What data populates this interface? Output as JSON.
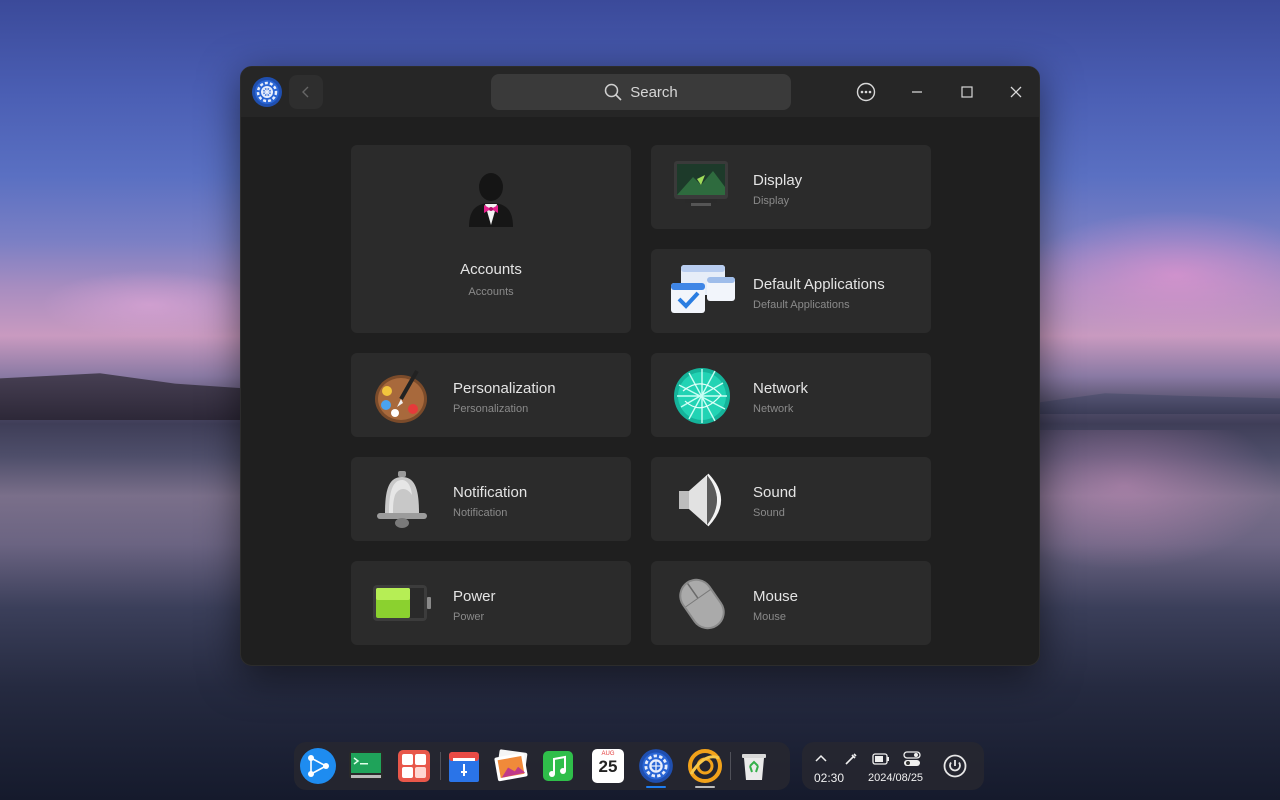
{
  "window": {
    "search_placeholder": "Search"
  },
  "cards": [
    {
      "id": "accounts",
      "title": "Accounts",
      "subtitle": "Accounts",
      "icon": "user-tuxedo-icon"
    },
    {
      "id": "display",
      "title": "Display",
      "subtitle": "Display",
      "icon": "monitor-icon"
    },
    {
      "id": "default-applications",
      "title": "Default Applications",
      "subtitle": "Default Applications",
      "icon": "app-windows-check-icon"
    },
    {
      "id": "personalization",
      "title": "Personalization",
      "subtitle": "Personalization",
      "icon": "paint-palette-icon"
    },
    {
      "id": "network",
      "title": "Network",
      "subtitle": "Network",
      "icon": "network-globe-icon"
    },
    {
      "id": "notification",
      "title": "Notification",
      "subtitle": "Notification",
      "icon": "bell-icon"
    },
    {
      "id": "sound",
      "title": "Sound",
      "subtitle": "Sound",
      "icon": "speaker-icon"
    },
    {
      "id": "power",
      "title": "Power",
      "subtitle": "Power",
      "icon": "battery-icon"
    },
    {
      "id": "mouse",
      "title": "Mouse",
      "subtitle": "Mouse",
      "icon": "mouse-icon"
    }
  ],
  "dock": {
    "items": [
      "launcher-icon",
      "terminal-icon",
      "app-store-icon",
      "file-manager-icon",
      "image-viewer-icon",
      "music-icon",
      "calendar-icon",
      "settings-icon",
      "browser-icon",
      "trash-icon"
    ],
    "calendar_month": "AUG",
    "calendar_day": "25",
    "accent": "#1e7ef0"
  },
  "tray": {
    "time": "02:30",
    "date": "2024/08/25"
  }
}
